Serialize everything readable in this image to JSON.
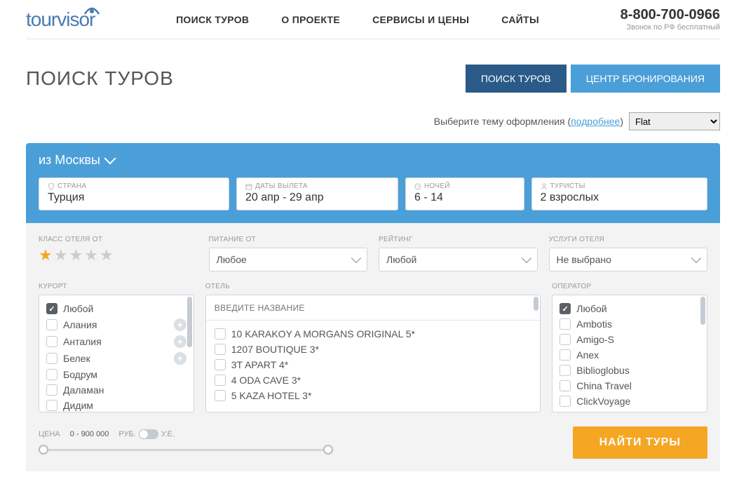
{
  "header": {
    "logo": "tourvisor",
    "nav": [
      "ПОИСК ТУРОВ",
      "О ПРОЕКТЕ",
      "СЕРВИСЫ И ЦЕНЫ",
      "САЙТЫ"
    ],
    "phone": "8-800-700-0966",
    "phone_sub": "Звонок по РФ бесплатный"
  },
  "title": "ПОИСК ТУРОВ",
  "tabs": {
    "active": "ПОИСК ТУРОВ",
    "inactive": "ЦЕНТР БРОНИРОВАНИЯ"
  },
  "theme": {
    "label": "Выберите тему оформления (",
    "link": "подробнее",
    "close": ")",
    "value": "Flat"
  },
  "from_city": "из Москвы",
  "params": {
    "country": {
      "label": "СТРАНА",
      "value": "Турция"
    },
    "dates": {
      "label": "ДАТЫ ВЫЛЕТА",
      "value": "20 апр - 29 апр"
    },
    "nights": {
      "label": "НОЧЕЙ",
      "value": "6 - 14"
    },
    "tourists": {
      "label": "ТУРИСТЫ",
      "value": "2 взрослых"
    }
  },
  "filters": {
    "class_label": "КЛАСС ОТЕЛЯ ОТ",
    "class_stars": 1,
    "meal": {
      "label": "ПИТАНИЕ ОТ",
      "value": "Любое"
    },
    "rating": {
      "label": "РЕЙТИНГ",
      "value": "Любой"
    },
    "services": {
      "label": "УСЛУГИ ОТЕЛЯ",
      "value": "Не выбрано"
    }
  },
  "resort": {
    "label": "КУРОРТ",
    "items": [
      {
        "name": "Любой",
        "checked": true,
        "plus": false
      },
      {
        "name": "Алания",
        "checked": false,
        "plus": true
      },
      {
        "name": "Анталия",
        "checked": false,
        "plus": true
      },
      {
        "name": "Белек",
        "checked": false,
        "plus": true
      },
      {
        "name": "Бодрум",
        "checked": false,
        "plus": false
      },
      {
        "name": "Даламан",
        "checked": false,
        "plus": false
      },
      {
        "name": "Дидим",
        "checked": false,
        "plus": false
      }
    ]
  },
  "hotel": {
    "label": "ОТЕЛЬ",
    "placeholder": "ВВЕДИТЕ НАЗВАНИЕ",
    "items": [
      "10 KARAKOY A MORGANS ORIGINAL 5*",
      "1207 BOUTIQUE 3*",
      "3T APART 4*",
      "4 ODA CAVE 3*",
      "5 KAZA HOTEL 3*"
    ]
  },
  "operator": {
    "label": "ОПЕРАТОР",
    "items": [
      {
        "name": "Любой",
        "checked": true
      },
      {
        "name": "Ambotis",
        "checked": false
      },
      {
        "name": "Amigo-S",
        "checked": false
      },
      {
        "name": "Anex",
        "checked": false
      },
      {
        "name": "Biblioglobus",
        "checked": false
      },
      {
        "name": "China Travel",
        "checked": false
      },
      {
        "name": "ClickVoyage",
        "checked": false
      }
    ]
  },
  "price": {
    "label": "ЦЕНА",
    "range": "0  -  900 000",
    "rub": "РУБ.",
    "ue": "У.Е."
  },
  "find_btn": "НАЙТИ ТУРЫ"
}
